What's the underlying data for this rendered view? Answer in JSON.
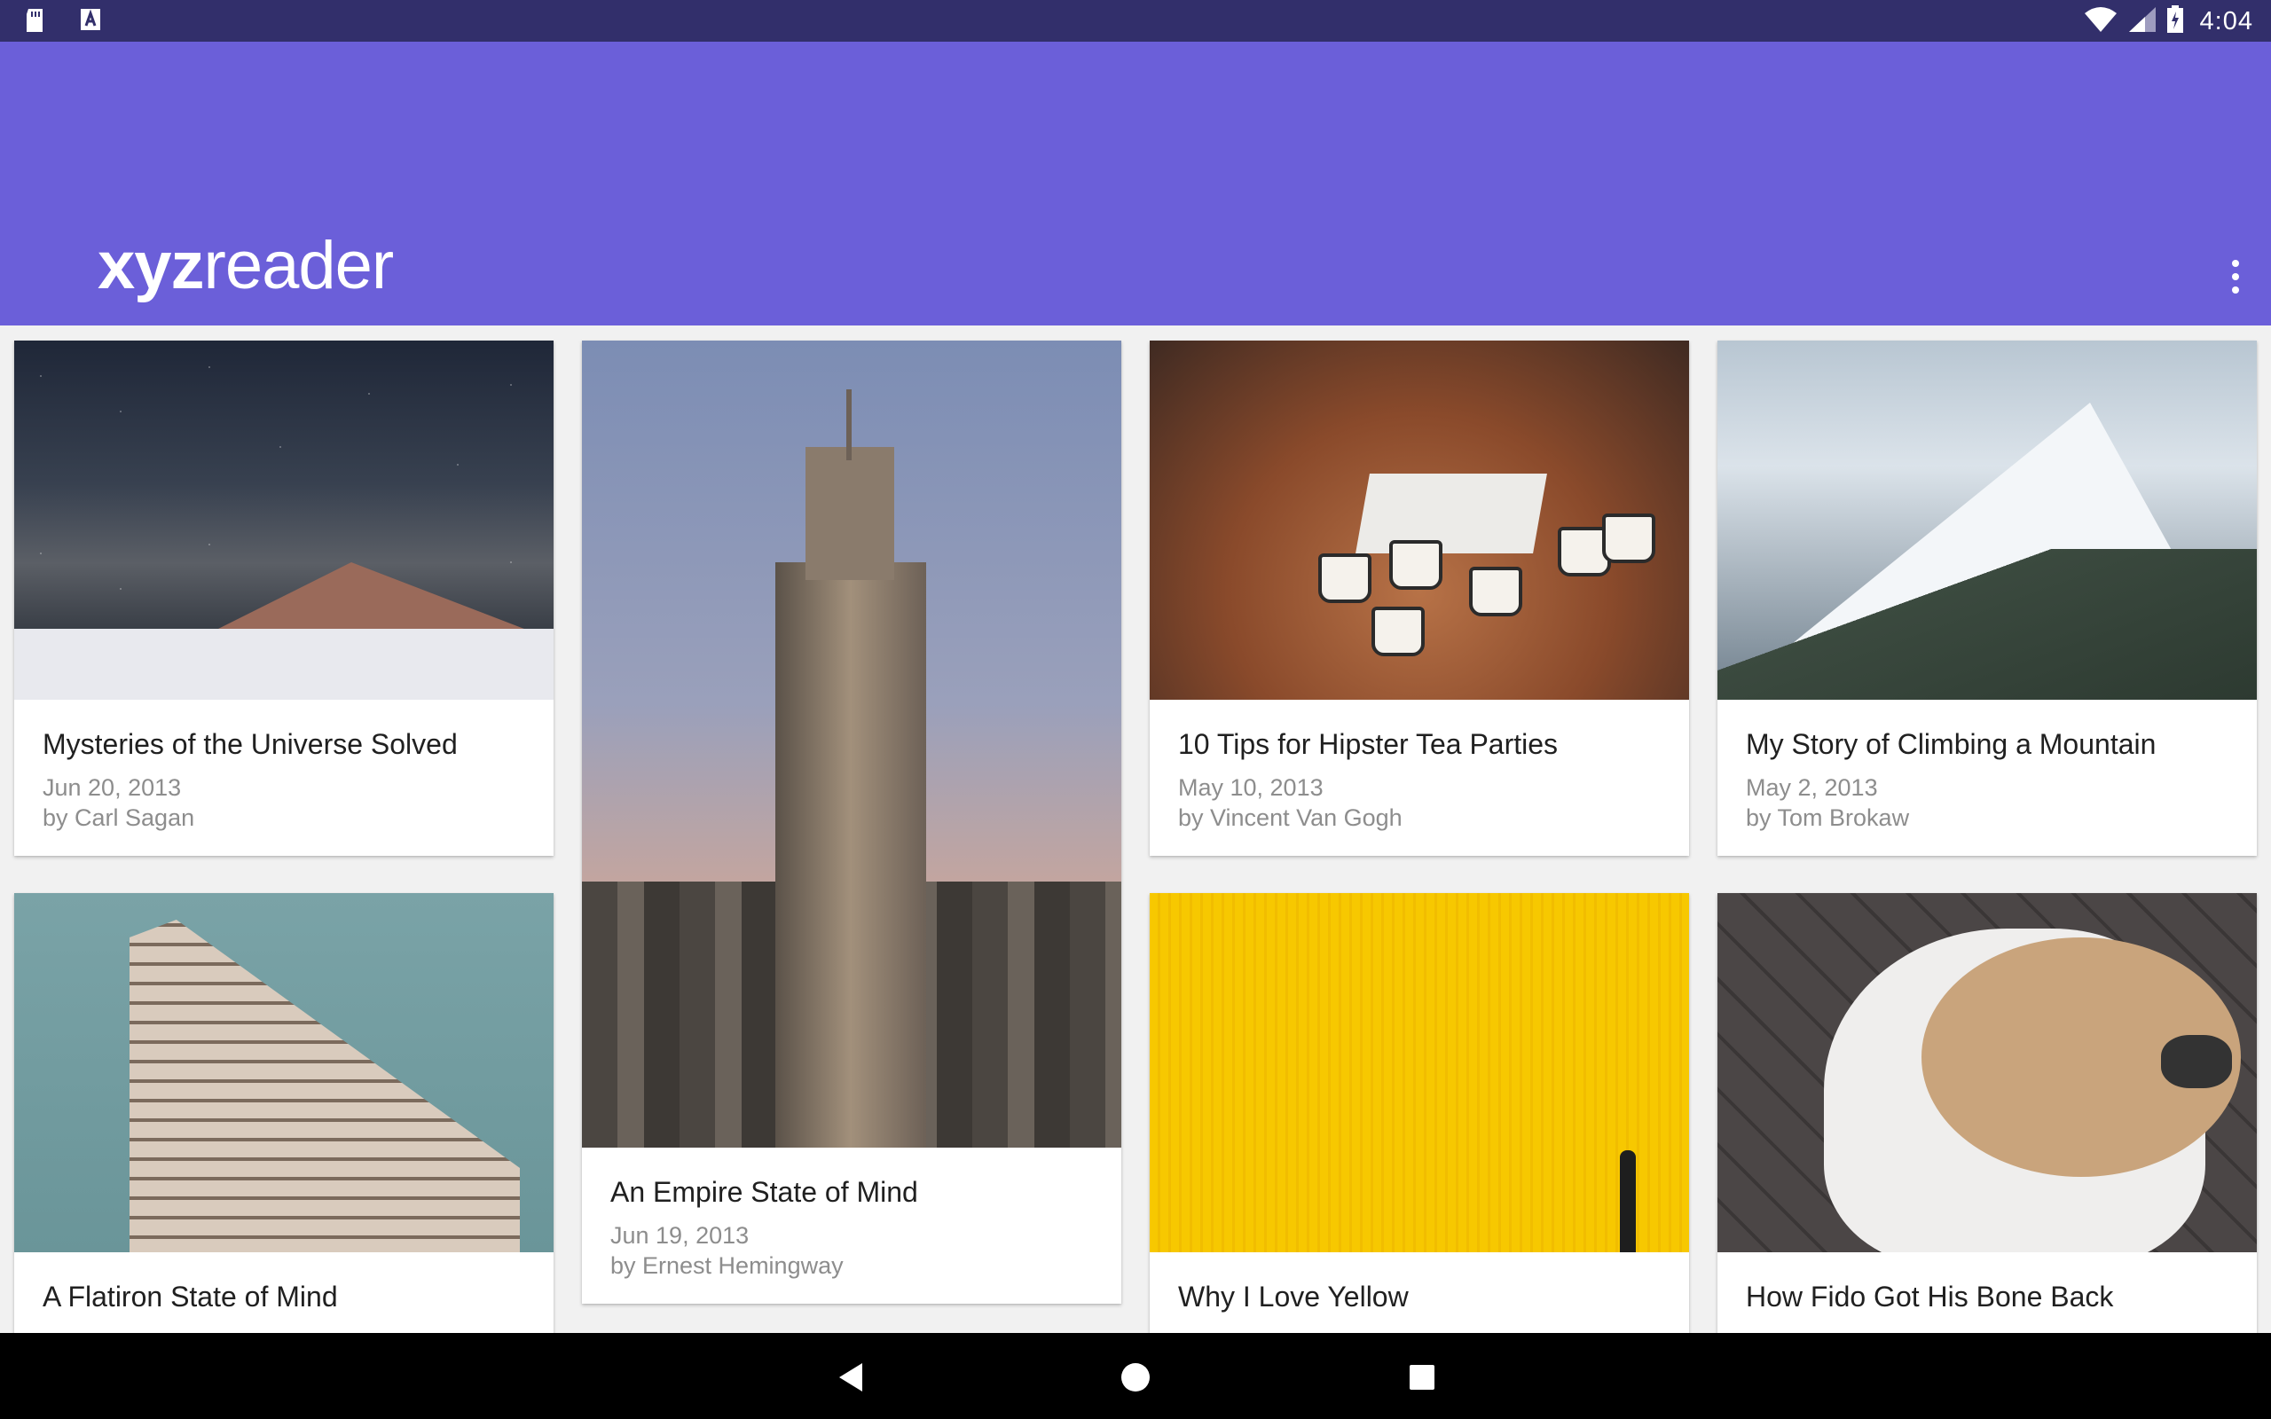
{
  "status_bar": {
    "time": "4:04",
    "left_icons": [
      "sd-card-icon",
      "text-input-icon"
    ],
    "right_icons": [
      "wifi-icon",
      "signal-icon",
      "battery-charging-icon"
    ]
  },
  "app_bar": {
    "logo_bold": "xyz",
    "logo_light": "reader",
    "menu_icon": "more-vert-icon"
  },
  "articles": [
    {
      "title": "Mysteries of the Universe Solved",
      "date": "Jun 20, 2013",
      "author": "by Carl Sagan"
    },
    {
      "title": "An Empire State of Mind",
      "date": "Jun 19, 2013",
      "author": "by Ernest Hemingway"
    },
    {
      "title": "10 Tips for Hipster Tea Parties",
      "date": "May 10, 2013",
      "author": "by Vincent Van Gogh"
    },
    {
      "title": "My Story of Climbing a Mountain",
      "date": "May 2, 2013",
      "author": "by Tom Brokaw"
    },
    {
      "title": "A Flatiron State of Mind",
      "date": "",
      "author": ""
    },
    {
      "title": "Why I Love Yellow",
      "date": "",
      "author": ""
    },
    {
      "title": "How Fido Got His Bone Back",
      "date": "",
      "author": ""
    }
  ],
  "nav_bar": {
    "icons": [
      "back-icon",
      "home-icon",
      "recents-icon"
    ]
  }
}
